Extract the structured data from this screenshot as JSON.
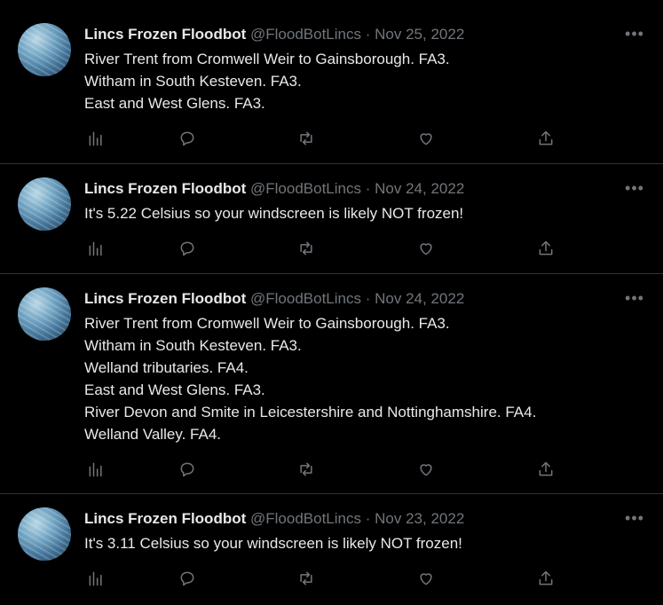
{
  "tweets": [
    {
      "name": "Lincs Frozen Floodbot",
      "handle": "@FloodBotLincs",
      "separator": "·",
      "date": "Nov 25, 2022",
      "lines": [
        "River Trent from Cromwell Weir to Gainsborough. FA3.",
        "Witham in South Kesteven. FA3.",
        "East and West Glens. FA3."
      ]
    },
    {
      "name": "Lincs Frozen Floodbot",
      "handle": "@FloodBotLincs",
      "separator": "·",
      "date": "Nov 24, 2022",
      "lines": [
        "It's 5.22 Celsius so your windscreen is likely NOT frozen!"
      ]
    },
    {
      "name": "Lincs Frozen Floodbot",
      "handle": "@FloodBotLincs",
      "separator": "·",
      "date": "Nov 24, 2022",
      "lines": [
        "River Trent from Cromwell Weir to Gainsborough. FA3.",
        "Witham in South Kesteven. FA3.",
        "Welland tributaries. FA4.",
        "East and West Glens. FA3.",
        "River Devon and Smite in Leicestershire and Nottinghamshire. FA4.",
        "Welland Valley. FA4."
      ]
    },
    {
      "name": "Lincs Frozen Floodbot",
      "handle": "@FloodBotLincs",
      "separator": "·",
      "date": "Nov 23, 2022",
      "lines": [
        "It's 3.11 Celsius so your windscreen is likely NOT frozen!"
      ]
    }
  ],
  "icons": {
    "more": "more-options-icon",
    "views": "views-chart-icon",
    "reply": "reply-bubble-icon",
    "retweet": "retweet-arrows-icon",
    "like": "heart-icon",
    "share": "share-upload-icon"
  },
  "colors": {
    "background": "#000000",
    "text": "#e7e9ea",
    "muted": "#71767b",
    "divider": "#2f3336"
  }
}
